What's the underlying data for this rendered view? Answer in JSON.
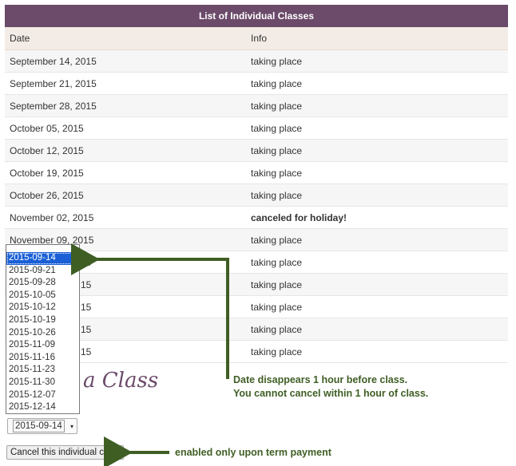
{
  "table": {
    "title": "List of Individual Classes",
    "headers": {
      "date": "Date",
      "info": "Info"
    },
    "rows": [
      {
        "date": "September 14, 2015",
        "info": "taking place"
      },
      {
        "date": "September 21, 2015",
        "info": "taking place"
      },
      {
        "date": "September 28, 2015",
        "info": "taking place"
      },
      {
        "date": "October 05, 2015",
        "info": "taking place"
      },
      {
        "date": "October 12, 2015",
        "info": "taking place"
      },
      {
        "date": "October 19, 2015",
        "info": "taking place"
      },
      {
        "date": "October 26, 2015",
        "info": "taking place"
      },
      {
        "date": "November 02, 2015",
        "info": "canceled for holiday!"
      },
      {
        "date": "November 09, 2015",
        "info": "taking place"
      },
      {
        "date": "15",
        "info": "taking place"
      },
      {
        "date": "15",
        "info": "taking place"
      },
      {
        "date": "15",
        "info": "taking place"
      },
      {
        "date": "15",
        "info": "taking place"
      },
      {
        "date": "15",
        "info": "taking place"
      }
    ]
  },
  "dropdown": {
    "selected": "2015-09-14",
    "options": [
      "2015-09-14",
      "2015-09-21",
      "2015-09-28",
      "2015-10-05",
      "2015-10-12",
      "2015-10-19",
      "2015-10-26",
      "2015-11-09",
      "2015-11-16",
      "2015-11-23",
      "2015-11-30",
      "2015-12-07",
      "2015-12-14"
    ]
  },
  "heading_partial": "a Class",
  "cancel_button": "Cancel this individual class",
  "annotations": {
    "line1": "Date disappears 1 hour before class.",
    "line2": "You cannot cancel within 1 hour of class.",
    "button_note": "enabled only upon term payment"
  },
  "colors": {
    "title_bar": "#6b4a6a",
    "annotation": "#3f5e24",
    "selection": "#1a5fd6"
  }
}
